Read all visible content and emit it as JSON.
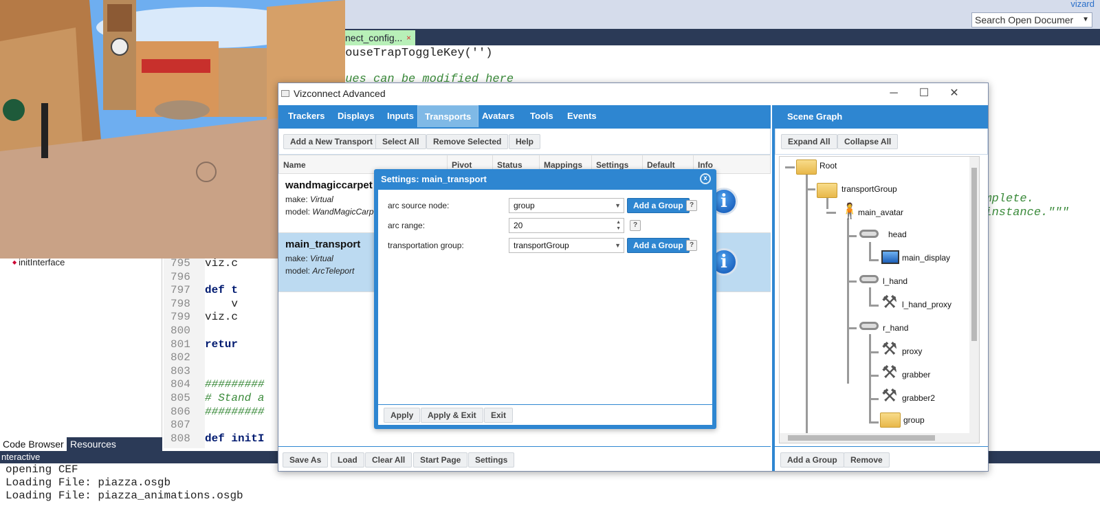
{
  "ide": {
    "brand": "vizard",
    "search_placeholder": "Search Open Documer",
    "editor_tab": "nect_config...",
    "editor_tab_close": "×",
    "code_top_line": "MouseTrapToggleKey('')",
    "code_comment_line": "lues can be modified here",
    "code_right_1": "complete.",
    "code_right_2": "n instance.\"\"\"",
    "left_item": "initInterface",
    "line_numbers": [
      "795",
      "796",
      "797",
      "798",
      "799",
      "800",
      "801",
      "802",
      "803",
      "804",
      "805",
      "806",
      "807",
      "808"
    ],
    "code_lines": [
      "viz.c",
      "",
      "def t",
      "    v",
      "viz.c",
      "",
      "retur",
      "",
      "",
      "#########",
      "# Stand a",
      "#########",
      "",
      "def initI"
    ],
    "bottom_tabs": [
      "Code Browser",
      "Resources"
    ],
    "interactive_label": "nteractive",
    "console_lines": [
      "opening CEF",
      "Loading File: piazza.osgb",
      "Loading File: piazza_animations.osgb"
    ]
  },
  "window": {
    "title": "Vizconnect Advanced",
    "minimize": "─",
    "maximize": "☐",
    "close": "✕"
  },
  "tabs": [
    "Trackers",
    "Displays",
    "Inputs",
    "Transports",
    "Avatars",
    "Tools",
    "Events"
  ],
  "active_tab": "Transports",
  "toolbar": [
    "Add a New Transport",
    "Select All",
    "Remove Selected",
    "Help"
  ],
  "table": {
    "columns": [
      "Name",
      "Pivot",
      "Status",
      "Mappings",
      "Settings",
      "Default",
      "Info"
    ],
    "rows": [
      {
        "name": "wandmagiccarpet",
        "make_label": "make:",
        "make": "Virtual",
        "model_label": "model:",
        "model": "WandMagicCarp",
        "info": "i"
      },
      {
        "name": "main_transport",
        "make_label": "make:",
        "make": "Virtual",
        "model_label": "model:",
        "model": "ArcTeleport",
        "info": "i"
      }
    ]
  },
  "bottom_buttons": [
    "Save As",
    "Load",
    "Clear All",
    "Start Page",
    "Settings"
  ],
  "scene_graph": {
    "title": "Scene Graph",
    "buttons": [
      "Expand All",
      "Collapse All"
    ],
    "nodes": [
      "Root",
      "transportGroup",
      "main_avatar",
      "head",
      "main_display",
      "l_hand",
      "l_hand_proxy",
      "r_hand",
      "proxy",
      "grabber",
      "grabber2",
      "group"
    ],
    "bottom_buttons": [
      "Add a Group",
      "Remove"
    ]
  },
  "settings_dialog": {
    "title": "Settings: main_transport",
    "close": "x",
    "fields": [
      {
        "label": "arc source node:",
        "value": "group",
        "button": "Add a Group",
        "help": "?"
      },
      {
        "label": "arc range:",
        "value": "20",
        "help": "?"
      },
      {
        "label": "transportation group:",
        "value": "transportGroup",
        "button": "Add a Group",
        "help": "?"
      }
    ],
    "footer_buttons": [
      "Apply",
      "Apply & Exit",
      "Exit"
    ]
  }
}
